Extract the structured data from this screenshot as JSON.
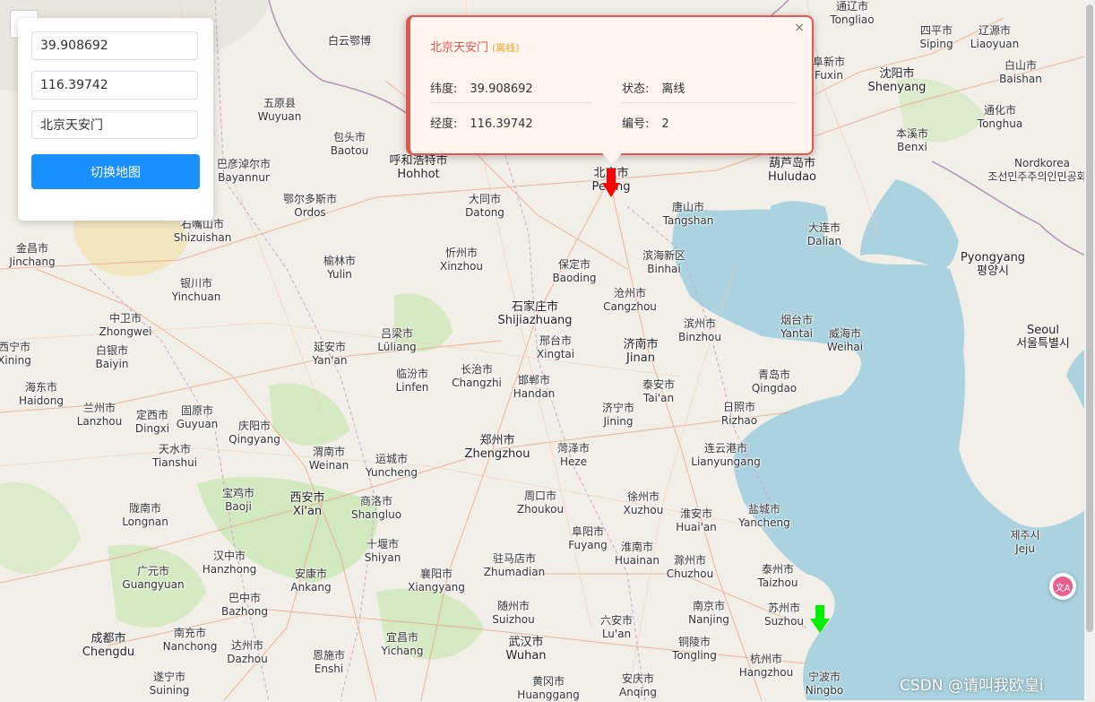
{
  "panel": {
    "latitude_value": "39.908692",
    "longitude_value": "116.39742",
    "name_value": "北京天安门",
    "switch_map_label": "切换地图"
  },
  "popup": {
    "title": "北京天安门",
    "status_tag": "(离线)",
    "close_label": "×",
    "latitude_label": "纬度:",
    "latitude_value": "39.908692",
    "status_label": "状态:",
    "status_value": "离线",
    "longitude_label": "经度:",
    "longitude_value": "116.39742",
    "id_label": "编号:",
    "id_value": "2"
  },
  "markers": [
    {
      "name": "beijing-marker",
      "color": "#ff0000"
    },
    {
      "name": "shanghai-marker",
      "color": "#00ee00"
    }
  ],
  "colors": {
    "land": "#f2efe9",
    "sea": "#aad3df",
    "accent": "#1890ff",
    "popup_border": "#e0584f"
  },
  "cities": [
    {
      "cn": "白云鄂博",
      "en": ""
    },
    {
      "cn": "五原县",
      "en": "Wuyuan"
    },
    {
      "cn": "包头市",
      "en": "Baotou"
    },
    {
      "cn": "呼和浩特市",
      "en": "Hohhot"
    },
    {
      "cn": "巴彦淖尔市",
      "en": "Bayannur"
    },
    {
      "cn": "鄂尔多斯市",
      "en": "Ordos"
    },
    {
      "cn": "大同市",
      "en": "Datong"
    },
    {
      "cn": "石嘴山市",
      "en": "Shizuishan"
    },
    {
      "cn": "金昌市",
      "en": "Jinchang"
    },
    {
      "cn": "银川市",
      "en": "Yinchuan"
    },
    {
      "cn": "榆林市",
      "en": "Yulin"
    },
    {
      "cn": "忻州市",
      "en": "Xinzhou"
    },
    {
      "cn": "保定市",
      "en": "Baoding"
    },
    {
      "cn": "石家庄市",
      "en": "Shijiazhuang"
    },
    {
      "cn": "沧州市",
      "en": "Cangzhou"
    },
    {
      "cn": "中卫市",
      "en": "Zhongwei"
    },
    {
      "cn": "西宁市",
      "en": "Xining"
    },
    {
      "cn": "白银市",
      "en": "Baiyin"
    },
    {
      "cn": "延安市",
      "en": "Yan'an"
    },
    {
      "cn": "吕梁市",
      "en": "Lüliang"
    },
    {
      "cn": "邢台市",
      "en": "Xingtai"
    },
    {
      "cn": "济南市",
      "en": "Jinan"
    },
    {
      "cn": "滨州市",
      "en": "Binzhou"
    },
    {
      "cn": "烟台市",
      "en": "Yantai"
    },
    {
      "cn": "威海市",
      "en": "Weihai"
    },
    {
      "cn": "海东市",
      "en": "Haidong"
    },
    {
      "cn": "兰州市",
      "en": "Lanzhou"
    },
    {
      "cn": "定西市",
      "en": "Dingxi"
    },
    {
      "cn": "固原市",
      "en": "Guyuan"
    },
    {
      "cn": "临汾市",
      "en": "Linfen"
    },
    {
      "cn": "长治市",
      "en": "Changzhi"
    },
    {
      "cn": "邯郸市",
      "en": "Handan"
    },
    {
      "cn": "泰安市",
      "en": "Tai'an"
    },
    {
      "cn": "青岛市",
      "en": "Qingdao"
    },
    {
      "cn": "庆阳市",
      "en": "Qingyang"
    },
    {
      "cn": "济宁市",
      "en": "Jining"
    },
    {
      "cn": "日照市",
      "en": "Rizhao"
    },
    {
      "cn": "天水市",
      "en": "Tianshui"
    },
    {
      "cn": "渭南市",
      "en": "Weinan"
    },
    {
      "cn": "运城市",
      "en": "Yuncheng"
    },
    {
      "cn": "郑州市",
      "en": "Zhengzhou"
    },
    {
      "cn": "菏泽市",
      "en": "Heze"
    },
    {
      "cn": "连云港市",
      "en": "Lianyungang"
    },
    {
      "cn": "西安市",
      "en": "Xi'an"
    },
    {
      "cn": "宝鸡市",
      "en": "Baoji"
    },
    {
      "cn": "商洛市",
      "en": "Shangluo"
    },
    {
      "cn": "周口市",
      "en": "Zhoukou"
    },
    {
      "cn": "徐州市",
      "en": "Xuzhou"
    },
    {
      "cn": "盐城市",
      "en": "Yancheng"
    },
    {
      "cn": "陇南市",
      "en": "Longnan"
    },
    {
      "cn": "十堰市",
      "en": "Shiyan"
    },
    {
      "cn": "阜阳市",
      "en": "Fuyang"
    },
    {
      "cn": "淮安市",
      "en": "Huai'an"
    },
    {
      "cn": "汉中市",
      "en": "Hanzhong"
    },
    {
      "cn": "安康市",
      "en": "Ankang"
    },
    {
      "cn": "襄阳市",
      "en": "Xiangyang"
    },
    {
      "cn": "驻马店市",
      "en": "Zhumadian"
    },
    {
      "cn": "淮南市",
      "en": "Huainan"
    },
    {
      "cn": "滁州市",
      "en": "Chuzhou"
    },
    {
      "cn": "泰州市",
      "en": "Taizhou"
    },
    {
      "cn": "广元市",
      "en": "Guangyuan"
    },
    {
      "cn": "巴中市",
      "en": "Bazhong"
    },
    {
      "cn": "随州市",
      "en": "Suizhou"
    },
    {
      "cn": "六安市",
      "en": "Lu'an"
    },
    {
      "cn": "南京市",
      "en": "Nanjing"
    },
    {
      "cn": "苏州市",
      "en": "Suzhou"
    },
    {
      "cn": "南充市",
      "en": "Nanchong"
    },
    {
      "cn": "达州市",
      "en": "Dazhou"
    },
    {
      "cn": "宜昌市",
      "en": "Yichang"
    },
    {
      "cn": "武汉市",
      "en": "Wuhan"
    },
    {
      "cn": "铜陵市",
      "en": "Tongling"
    },
    {
      "cn": "杭州市",
      "en": "Hangzhou"
    },
    {
      "cn": "成都市",
      "en": "Chengdu"
    },
    {
      "cn": "恩施市",
      "en": "Enshi"
    },
    {
      "cn": "黄冈市",
      "en": "Huanggang"
    },
    {
      "cn": "安庆市",
      "en": "Anqing"
    },
    {
      "cn": "宁波市",
      "en": "Ningbo"
    },
    {
      "cn": "遂宁市",
      "en": "Suining"
    },
    {
      "cn": "唐山市",
      "en": "Tangshan"
    },
    {
      "cn": "滨海新区",
      "en": "Binhai"
    },
    {
      "cn": "葫芦岛市",
      "en": "Huludao"
    },
    {
      "cn": "大连市",
      "en": "Dalian"
    },
    {
      "cn": "沈阳市",
      "en": "Shenyang"
    },
    {
      "cn": "本溪市",
      "en": "Benxi"
    },
    {
      "cn": "通化市",
      "en": "Tonghua"
    },
    {
      "cn": "白山市",
      "en": "Baishan"
    },
    {
      "cn": "通辽市",
      "en": "Tongliao"
    },
    {
      "cn": "辽源市",
      "en": "Liaoyuan"
    },
    {
      "cn": "四平市",
      "en": "Siping"
    },
    {
      "cn": "阜新市",
      "en": "Fuxin"
    },
    {
      "cn": "Pyongyang",
      "en": "평양시"
    },
    {
      "cn": "Seoul",
      "en": "서울특별시"
    },
    {
      "cn": "Nordkorea",
      "en": "조선민주주의인민공화국"
    },
    {
      "cn": "제주시",
      "en": "Jeju"
    },
    {
      "cn": "北京市",
      "en": "Peking"
    }
  ],
  "watermark": "CSDN @请叫我欧皇i"
}
